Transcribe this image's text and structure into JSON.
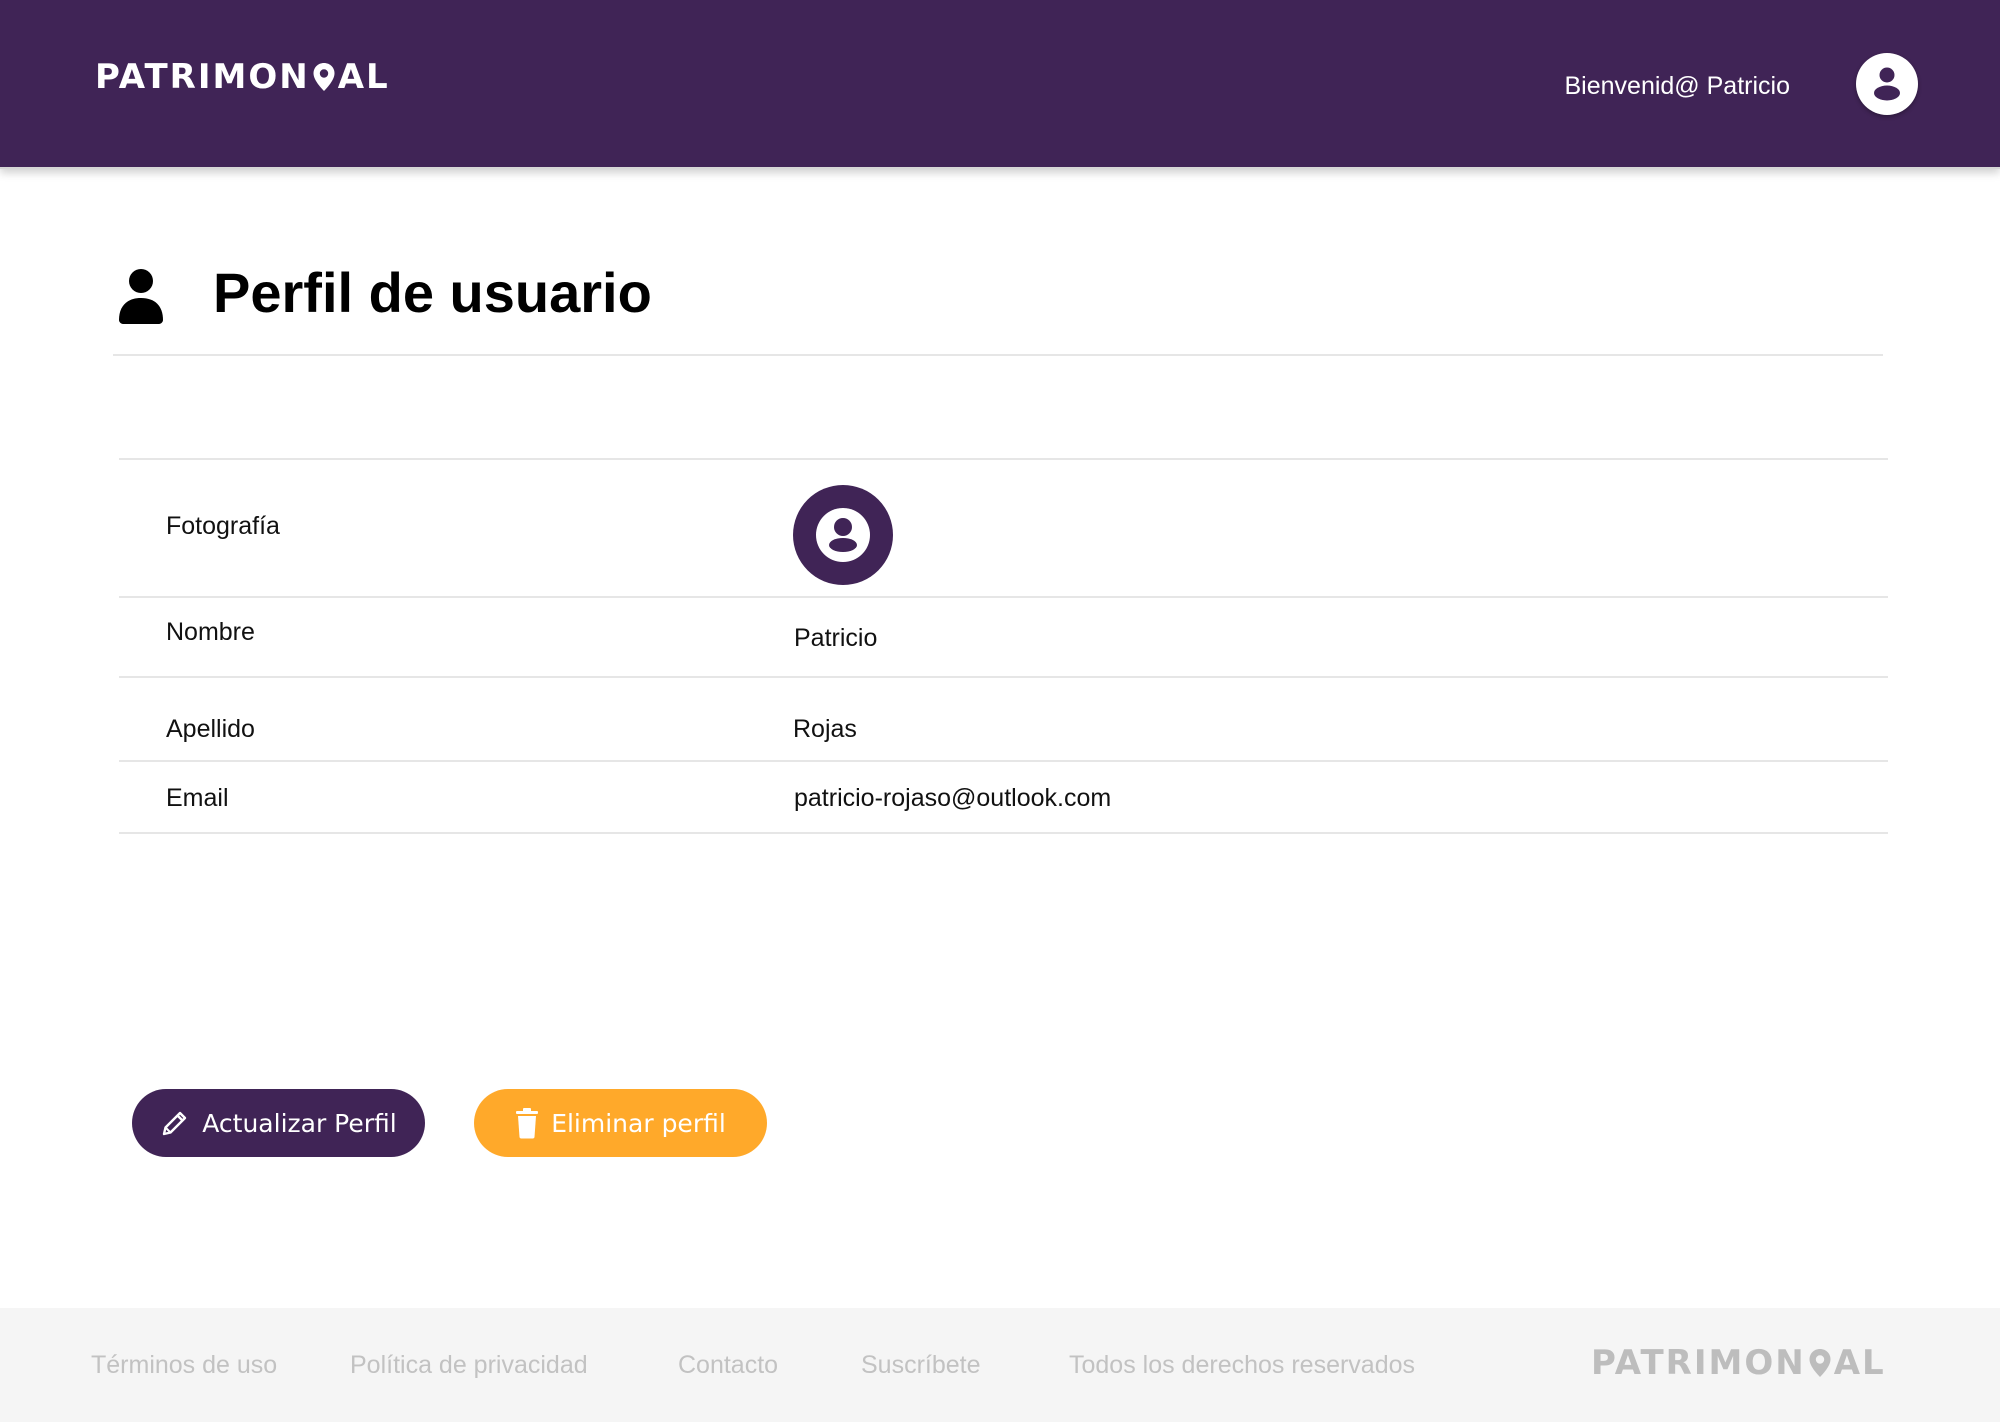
{
  "colors": {
    "primary": "#402456",
    "accent": "#ffa92a",
    "footer_bg": "#f5f5f5",
    "footer_text": "#c2c2c2"
  },
  "header": {
    "brand_before": "PATRIMON",
    "brand_after": "AL",
    "brand_icon": "map-pin-icon",
    "welcome": "Bienvenid@ Patricio",
    "avatar_icon": "user-circle-icon"
  },
  "page": {
    "title": "Perfil de usuario",
    "title_icon": "user-icon"
  },
  "profile": {
    "photo_label": "Fotografía",
    "photo_icon": "user-circle-icon",
    "first_name_label": "Nombre",
    "first_name": "Patricio",
    "last_name_label": "Apellido",
    "last_name": "Rojas",
    "email_label": "Email",
    "email": "patricio-rojaso@outlook.com"
  },
  "actions": {
    "update_label": "Actualizar Perfil",
    "update_icon": "pencil-icon",
    "delete_label": "Eliminar perfil",
    "delete_icon": "trash-icon"
  },
  "footer": {
    "terms": "Términos de uso",
    "privacy": "Política de privacidad",
    "contact": "Contacto",
    "subscribe": "Suscríbete",
    "rights": "Todos los derechos reservados",
    "brand_before": "PATRIMON",
    "brand_after": "AL"
  }
}
